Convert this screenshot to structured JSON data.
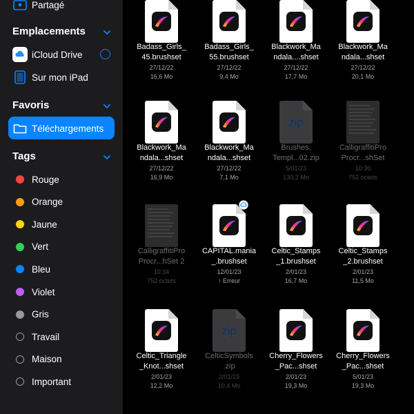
{
  "sidebar": {
    "partage_label": "Partagé",
    "locations_title": "Emplacements",
    "icloud_label": "iCloud Drive",
    "ipad_label": "Sur mon iPad",
    "favorites_title": "Favoris",
    "downloads_label": "Téléchargements",
    "tags_title": "Tags",
    "tags": [
      {
        "label": "Rouge",
        "color": "#ff453a"
      },
      {
        "label": "Orange",
        "color": "#ff9f0a"
      },
      {
        "label": "Jaune",
        "color": "#ffd60a"
      },
      {
        "label": "Vert",
        "color": "#30d158"
      },
      {
        "label": "Bleu",
        "color": "#0a84ff"
      },
      {
        "label": "Violet",
        "color": "#bf5af2"
      },
      {
        "label": "Gris",
        "color": "#98989d"
      },
      {
        "label": "Travail",
        "color": ""
      },
      {
        "label": "Maison",
        "color": ""
      },
      {
        "label": "Important",
        "color": ""
      }
    ]
  },
  "files": [
    {
      "name1": "Badass_Girls_",
      "name2": "45.brushset",
      "date": "27/12/22",
      "size": "16,6 Mo"
    },
    {
      "name1": "Badass_Girls_",
      "name2": "55.brushset",
      "date": "27/12/22",
      "size": "9,4 Mo"
    },
    {
      "name1": "Blackwork_Ma",
      "name2": "ndala....shset",
      "date": "27/12/22",
      "size": "17,7 Mo"
    },
    {
      "name1": "Blackwork_Ma",
      "name2": "ndala...shset",
      "date": "27/12/22",
      "size": "20,1 Mo"
    },
    {
      "name1": "Blackwork_Ma",
      "name2": "ndala...shset",
      "date": "27/12/22",
      "size": "16,9 Mo"
    },
    {
      "name1": "Blackwork_Ma",
      "name2": "ndala...shset",
      "date": "27/12/22",
      "size": "7,1 Mo"
    },
    {
      "name1": "Brushes,",
      "name2": "Templ...02.zip",
      "date": "5/01/23",
      "size": "130,2 Mo"
    },
    {
      "name1": "CalligraffitiPro",
      "name2": "Procr...shSet",
      "date": "10:30",
      "size": "752 octets"
    },
    {
      "name1": "CalligraffitiPro",
      "name2": "Procr...hSet 2",
      "date": "10:34",
      "size": "752 octets"
    },
    {
      "name1": "CAPITAL.mania",
      "name2": "_.brushset",
      "date": "12/01/23",
      "size": "↑ Erreur"
    },
    {
      "name1": "Celtic_Stamps",
      "name2": "_1.brushset",
      "date": "2/01/23",
      "size": "16,7 Mo"
    },
    {
      "name1": "Celtic_Stamps",
      "name2": "_2.brushset",
      "date": "2/01/23",
      "size": "11,5 Mo"
    },
    {
      "name1": "Celtic_Triangle",
      "name2": "_Knot...shset",
      "date": "2/01/23",
      "size": "12,2 Mo"
    },
    {
      "name1": "CelticSymbols",
      "name2": ".zip",
      "date": "2/01/23",
      "size": "10,4 Mo"
    },
    {
      "name1": "Cherry_Flowers",
      "name2": "_Pac...shset",
      "date": "2/01/23",
      "size": "19,3 Mo"
    },
    {
      "name1": "Cherry_Flowers",
      "name2": "_Pac...shset",
      "date": "5/01/23",
      "size": "19,3 Mo"
    }
  ],
  "zip_label": "zip"
}
